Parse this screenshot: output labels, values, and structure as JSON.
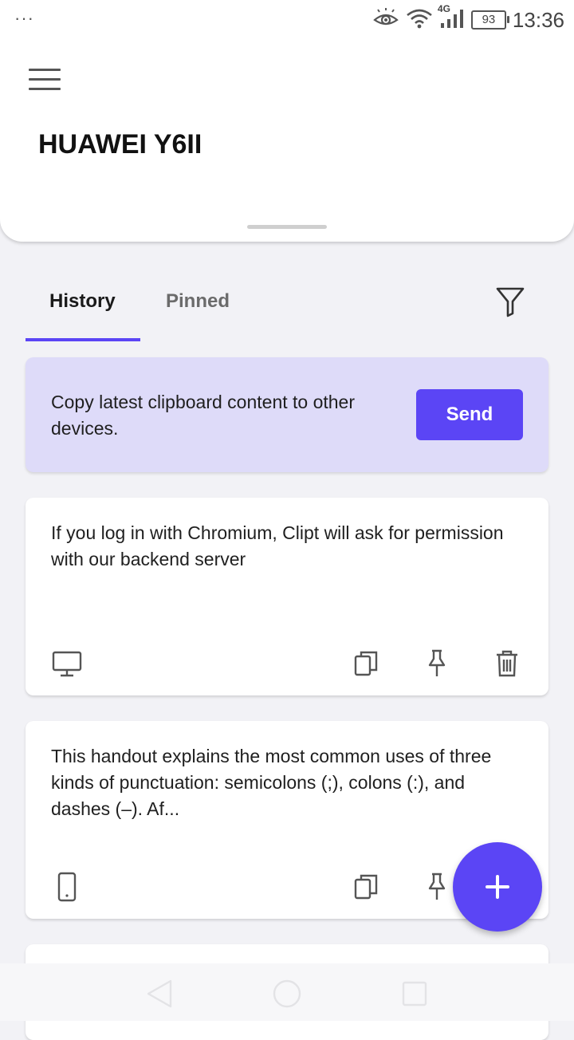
{
  "status_bar": {
    "dots": "···",
    "network": "4G",
    "battery": "93",
    "time": "13:36",
    "icons": [
      "eye-comfort-icon",
      "wifi-icon",
      "signal-icon",
      "battery-icon"
    ]
  },
  "header": {
    "device_name": "HUAWEI Y6II"
  },
  "tabs": {
    "history": "History",
    "pinned": "Pinned",
    "active": "History"
  },
  "promo": {
    "text": "Copy latest clipboard content to other devices.",
    "button": "Send"
  },
  "clips": [
    {
      "text": "If you log in with Chromium, Clipt will ask for permission with our backend server",
      "source_icon": "desktop-icon"
    },
    {
      "text": "This handout explains the most common uses of three kinds of punctuation: semicolons (;), colons (:), and dashes (–). Af...",
      "source_icon": "phone-icon"
    }
  ],
  "fab": {
    "icon": "plus-icon"
  },
  "colors": {
    "accent": "#5b45f5",
    "promo_bg": "#dedbf9",
    "page_bg": "#f2f2f6"
  }
}
